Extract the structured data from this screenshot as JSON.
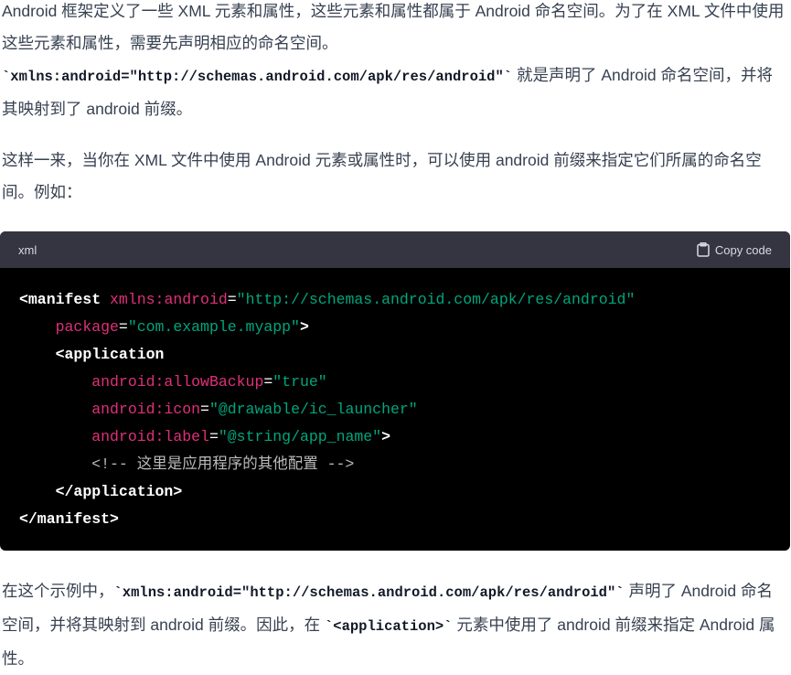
{
  "para1": {
    "t1": "Android 框架定义了一些 XML 元素和属性，这些元素和属性都属于 Android 命名空间。为了在 XML 文件中使用这些元素和属性，需要先声明相应的命名空间。",
    "code": "`xmlns:android=\"http://schemas.android.com/apk/res/android\"`",
    "t2": " 就是声明了 Android 命名空间，并将其映射到了 android 前缀。"
  },
  "para2": {
    "t1": "这样一来，当你在 XML 文件中使用 Android 元素或属性时，可以使用 android 前缀来指定它们所属的命名空间。例如："
  },
  "code_block": {
    "language": "xml",
    "copy_label": "Copy code",
    "copy_icon": "clipboard-icon",
    "lines": [
      [
        {
          "t": "<manifest",
          "c": "tag"
        },
        {
          "t": " ",
          "c": ""
        },
        {
          "t": "xmlns:android",
          "c": "attr"
        },
        {
          "t": "=",
          "c": "eq"
        },
        {
          "t": "\"http://schemas.android.com/apk/res/android\"",
          "c": "str"
        }
      ],
      [
        {
          "t": "    ",
          "c": ""
        },
        {
          "t": "package",
          "c": "attr"
        },
        {
          "t": "=",
          "c": "eq"
        },
        {
          "t": "\"com.example.myapp\"",
          "c": "str"
        },
        {
          "t": ">",
          "c": "tag"
        }
      ],
      [
        {
          "t": "    ",
          "c": ""
        },
        {
          "t": "<application",
          "c": "tag"
        }
      ],
      [
        {
          "t": "        ",
          "c": ""
        },
        {
          "t": "android:allowBackup",
          "c": "attr"
        },
        {
          "t": "=",
          "c": "eq"
        },
        {
          "t": "\"true\"",
          "c": "str"
        }
      ],
      [
        {
          "t": "        ",
          "c": ""
        },
        {
          "t": "android:icon",
          "c": "attr"
        },
        {
          "t": "=",
          "c": "eq"
        },
        {
          "t": "\"@drawable/ic_launcher\"",
          "c": "str"
        }
      ],
      [
        {
          "t": "        ",
          "c": ""
        },
        {
          "t": "android:label",
          "c": "attr"
        },
        {
          "t": "=",
          "c": "eq"
        },
        {
          "t": "\"@string/app_name\"",
          "c": "str"
        },
        {
          "t": ">",
          "c": "tag"
        }
      ],
      [
        {
          "t": "        ",
          "c": ""
        },
        {
          "t": "<!-- 这里是应用程序的其他配置 -->",
          "c": "cmt"
        }
      ],
      [
        {
          "t": "    ",
          "c": ""
        },
        {
          "t": "</application>",
          "c": "tag"
        }
      ],
      [
        {
          "t": "</manifest>",
          "c": "tag"
        }
      ]
    ]
  },
  "para3": {
    "t1": "在这个示例中，",
    "code1": "`xmlns:android=\"http://schemas.android.com/apk/res/android\"`",
    "t2": " 声明了 Android 命名空间，并将其映射到 android 前缀。因此，在 ",
    "code2": "`<application>`",
    "t3": " 元素中使用了 android 前缀来指定 Android 属性。"
  }
}
